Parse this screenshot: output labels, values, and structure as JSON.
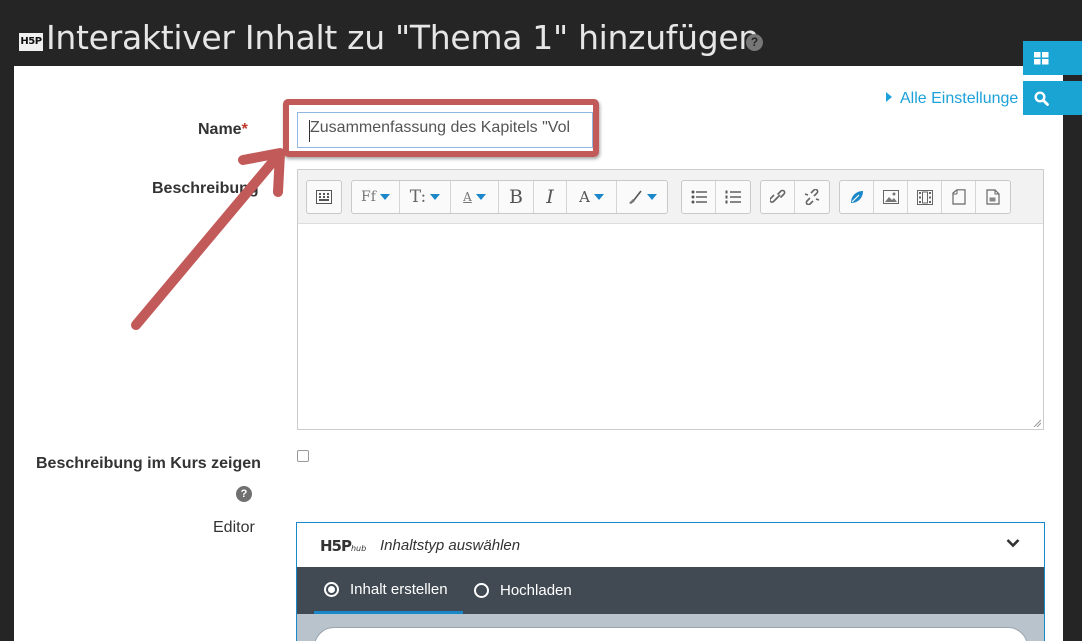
{
  "header": {
    "logo_text": "H5P",
    "title": "Interaktiver Inhalt zu \"Thema 1\" hinzufügen",
    "help_glyph": "?"
  },
  "links": {
    "all_settings": "Alle Einstellunge"
  },
  "side_buttons": [
    {
      "icon": "blocks-icon"
    },
    {
      "icon": "search-icon"
    }
  ],
  "form": {
    "name_label": "Name",
    "required_mark": "*",
    "name_value": "Zusammenfassung des Kapitels \"Vol",
    "description_label": "Beschreibung",
    "show_description_label": "Beschreibung im Kurs zeigen",
    "show_description_checked": false,
    "help_glyph": "?",
    "editor_label": "Editor"
  },
  "toolbar": {
    "font_family": "Ff",
    "font_size": "T:",
    "style": "A",
    "bold": "B",
    "italic": "I",
    "font_color": "A"
  },
  "hub": {
    "logo_text": "H5P",
    "logo_sub": "hub",
    "title": "Inhaltstyp auswählen",
    "tabs": [
      {
        "label": "Inhalt erstellen",
        "selected": true
      },
      {
        "label": "Hochladen",
        "selected": false
      }
    ]
  },
  "colors": {
    "accent": "#1aa4d4",
    "link": "#1da1d9",
    "highlight": "#c25a5a",
    "hub_bar": "#414a53"
  }
}
